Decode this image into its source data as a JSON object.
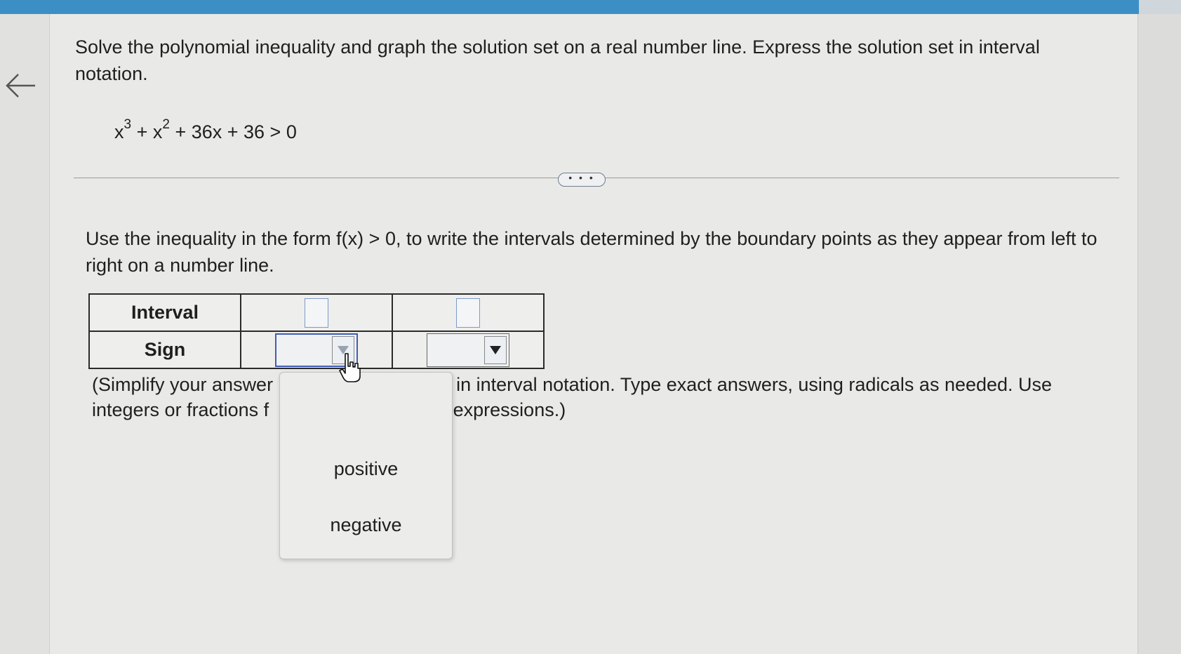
{
  "header": {
    "accent_color": "#3c8fc5"
  },
  "nav": {
    "back_icon": "left-arrow-icon"
  },
  "question": {
    "prompt": "Solve the polynomial inequality and graph the solution set on a real number line. Express the solution set in interval notation.",
    "equation": {
      "term1": "x",
      "exp1": "3",
      "plus1": " + ",
      "term2": "x",
      "exp2": "2",
      "rest": " + 36x + 36 > 0"
    }
  },
  "divider": {
    "more_label": "• • •"
  },
  "step": {
    "instruction": "Use the inequality in the form f(x) > 0, to write the intervals determined by the boundary points as they appear from left to right on a number line.",
    "table": {
      "row1_header": "Interval",
      "row2_header": "Sign"
    },
    "note_part1": "(Simplify your answer",
    "note_part2": "s in interval notation. Type exact answers, using radicals as needed. Use",
    "note_part3": "integers or fractions f",
    "note_part4": "e expressions.)"
  },
  "dropdown": {
    "options": [
      "positive",
      "negative"
    ]
  }
}
